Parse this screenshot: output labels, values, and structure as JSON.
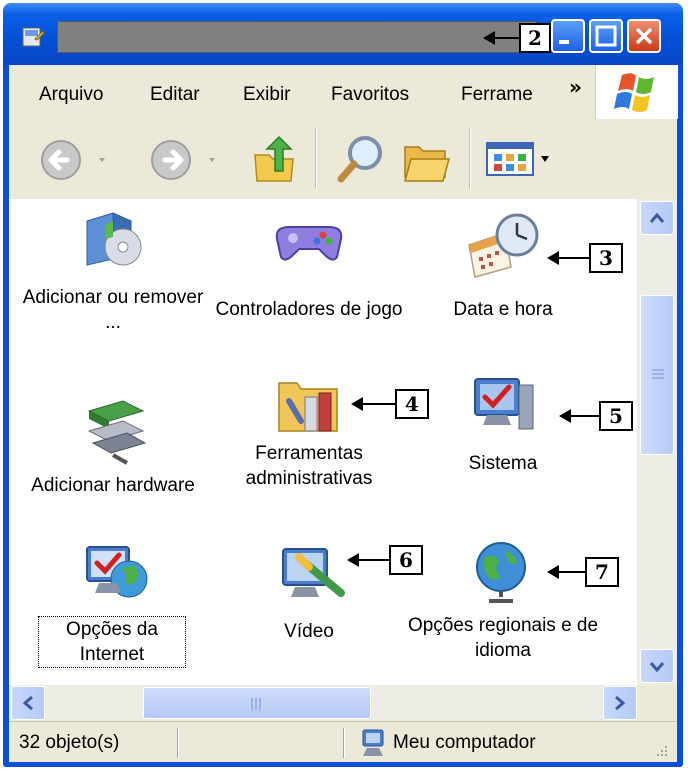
{
  "window": {
    "title": ""
  },
  "callouts": {
    "title_bar": "2",
    "data_hora": "3",
    "ferramentas": "4",
    "sistema": "5",
    "video": "6",
    "opcoes_regionais": "7"
  },
  "menu": {
    "items": [
      "Arquivo",
      "Editar",
      "Exibir",
      "Favoritos",
      "Ferrame"
    ],
    "overflow": "»"
  },
  "toolbar": {
    "buttons": [
      "back-icon",
      "forward-icon",
      "up-folder-icon",
      "search-icon",
      "folders-icon",
      "views-icon"
    ]
  },
  "items": [
    {
      "label": "Adicionar ou remover ...",
      "icon": "add-remove-programs-icon"
    },
    {
      "label": "Controladores de jogo",
      "icon": "game-controller-icon"
    },
    {
      "label": "Data e hora",
      "icon": "date-time-icon"
    },
    {
      "label": "Adicionar hardware",
      "icon": "add-hardware-icon"
    },
    {
      "label": "Ferramentas administrativas",
      "icon": "admin-tools-icon"
    },
    {
      "label": "Sistema",
      "icon": "system-icon"
    },
    {
      "label": "Opções da Internet",
      "icon": "internet-options-icon"
    },
    {
      "label": "Vídeo",
      "icon": "display-icon"
    },
    {
      "label": "Opções regionais e de idioma",
      "icon": "regional-options-icon"
    }
  ],
  "status": {
    "count": "32 objeto(s)",
    "location": "Meu computador"
  },
  "colors": {
    "titlebar": "#0a5fe8",
    "close_button": "#cc3a18",
    "chrome": "#ece9d8"
  }
}
